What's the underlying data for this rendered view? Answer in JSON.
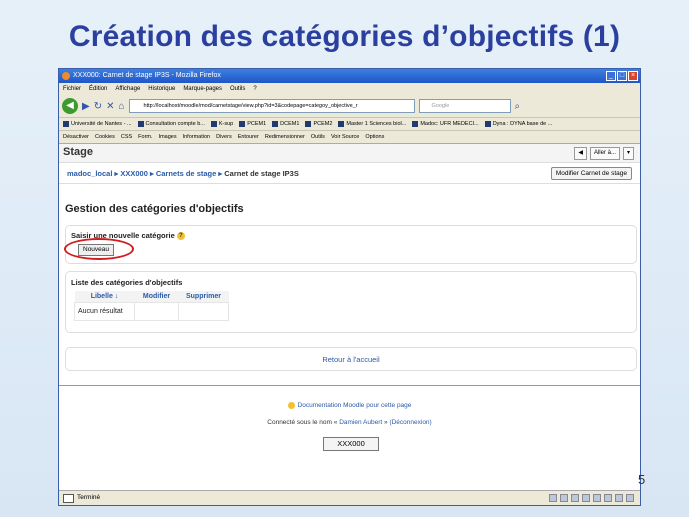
{
  "slide": {
    "title": "Création des catégories d’objectifs (1)",
    "page_number": "5"
  },
  "browser": {
    "window_title": "XXX000: Carnet de stage IP3S - Mozilla Firefox",
    "menu": [
      "Fichier",
      "Édition",
      "Affichage",
      "Historique",
      "Marque-pages",
      "Outils",
      "?"
    ],
    "url": "http://localhost/moodle/mod/carnetstage/view.php?id=3&codepage=categoy_objective_r",
    "search_placeholder": "Google",
    "bookmarks": [
      "Université de Nantes - ...",
      "Consultation compte b...",
      "K-sup",
      "PCEM1",
      "DCEM1",
      "PCEM2",
      "Master 1 Sciences biol...",
      "Madoc: UFR MEDECI...",
      "Dyna : DYNA base de ..."
    ],
    "devtools": [
      "Désactiver",
      "Cookies",
      "CSS",
      "Form.",
      "Images",
      "Information",
      "Divers",
      "Entourer",
      "Redimensionner",
      "Outils",
      "Voir Source",
      "Options"
    ],
    "status_text": "Terminé"
  },
  "page": {
    "header_title": "Stage",
    "jump_select": "Aller à...",
    "breadcrumb": [
      "madoc_local",
      "XXX000",
      "Carnets de stage",
      "Carnet de stage IP3S"
    ],
    "edit_button": "Modifier Carnet de stage",
    "section_title": "Gestion des catégories d'objectifs",
    "new_category_label": "Saisir une nouvelle catégorie",
    "new_button": "Nouveau",
    "list_label": "Liste des catégories d'objectifs",
    "table_headers": [
      "Libelle ↓",
      "Modifier",
      "Supprimer"
    ],
    "empty_row": "Aucun résultat",
    "back_link": "Retour à l'accueil",
    "doc_link": "Documentation Moodle pour cette page",
    "logged_prefix": "Connecté sous le nom «",
    "logged_user": "Damien Aubert",
    "logged_suffix": "»",
    "logout": "(Déconnexion)",
    "course_button": "XXX000"
  }
}
